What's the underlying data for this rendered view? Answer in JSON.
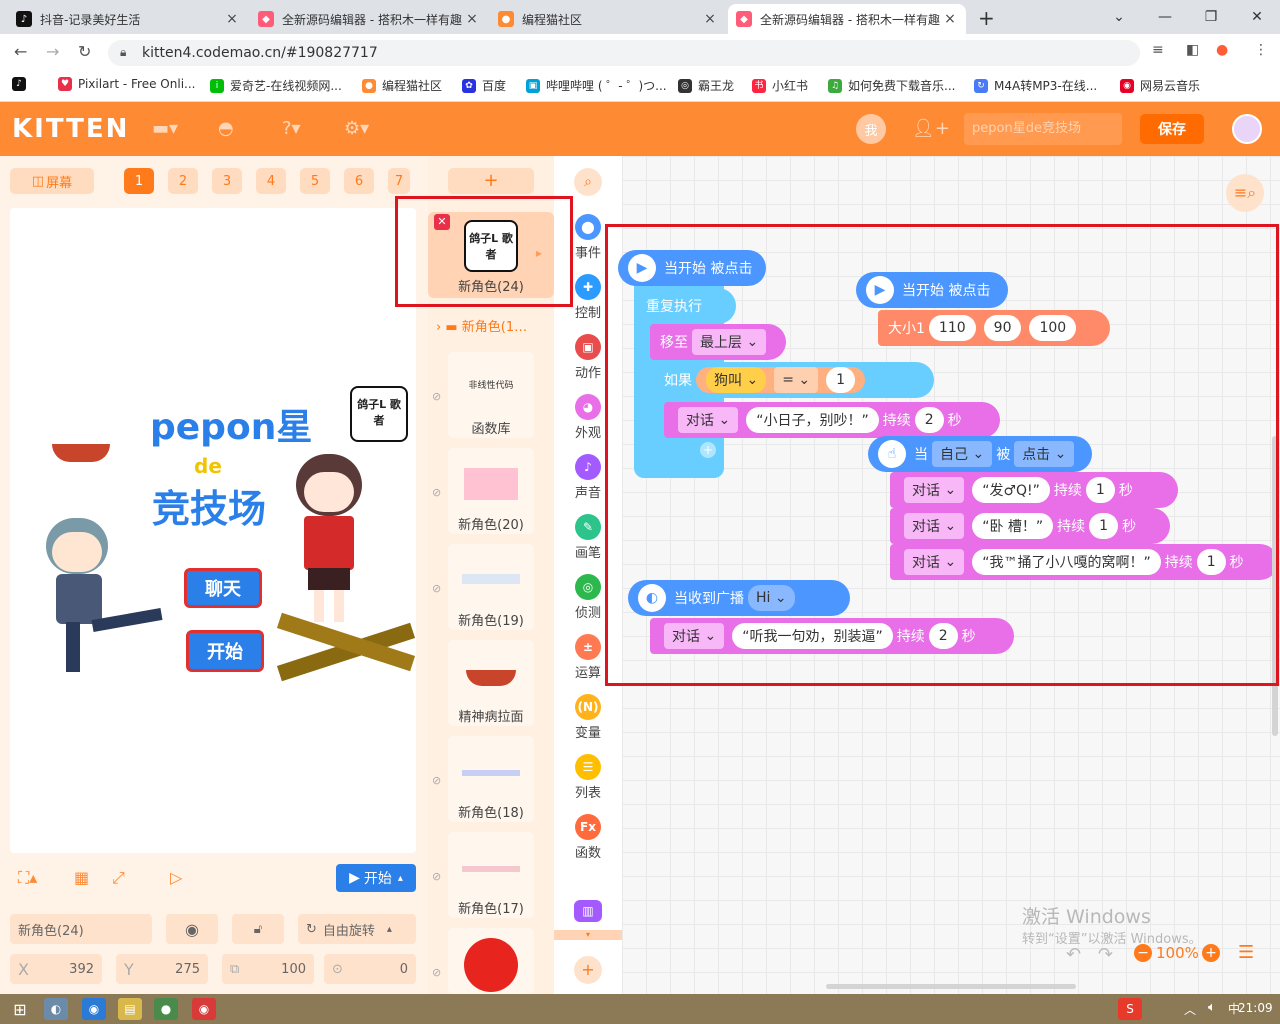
{
  "browser": {
    "tabs": [
      {
        "title": "抖音-记录美好生活",
        "active": false,
        "close": "×"
      },
      {
        "title": "全新源码编辑器 - 搭积木一样有趣",
        "active": false,
        "close": "×"
      },
      {
        "title": "编程猫社区",
        "active": false,
        "close": "×"
      },
      {
        "title": "全新源码编辑器 - 搭积木一样有趣",
        "active": true,
        "close": "×"
      }
    ],
    "new_tab": "+",
    "url": "kitten4.codemao.cn/#190827717",
    "bookmarks": [
      "Pixilart - Free Onli...",
      "爱奇艺-在线视频网...",
      "编程猫社区",
      "百度",
      "哔哩哔哩 ( ゜- ゜)つ...",
      "霸王龙",
      "小红书",
      "如何免费下载音乐...",
      "M4A转MP3-在线...",
      "网易云音乐"
    ]
  },
  "app": {
    "logo": "KITTEN",
    "me_label": "我",
    "project_name_placeholder": "pepon星de竞技场",
    "save_label": "保存"
  },
  "left": {
    "screen_toggle": "屏幕",
    "screens": [
      "1",
      "2",
      "3",
      "4",
      "5",
      "6",
      "7"
    ],
    "stage_title_1": "pepon星",
    "stage_title_2": "de",
    "stage_title_3": "竞技场",
    "stage_btn_chat": "聊天",
    "stage_btn_start": "开始",
    "sprite_badge": "鸽子L 歌者",
    "start_label": "开始",
    "sprite_name": "新角色(24)",
    "rotation_label": "自由旋转",
    "x_label": "X",
    "x_value": "392",
    "y_label": "Y",
    "y_value": "275",
    "size_value": "100",
    "angle_value": "0"
  },
  "sprites": {
    "add": "+",
    "selected_label": "新角色(24)",
    "selected_thumb": "鸽子L 歌者",
    "folder_label": "新角色(1…",
    "items": [
      "函数库",
      "新角色(20)",
      "新角色(19)",
      "精神病拉面",
      "新角色(18)",
      "新角色(17)"
    ],
    "item0_thumb": "非线性代码"
  },
  "categories": [
    "事件",
    "控制",
    "动作",
    "外观",
    "声音",
    "画笔",
    "侦测",
    "运算",
    "变量",
    "列表",
    "函数"
  ],
  "category_colors": [
    "#4c97ff",
    "#2b9bff",
    "#e84c4c",
    "#e86fe8",
    "#a35bff",
    "#2cc48a",
    "#2cb84c",
    "#ff7a52",
    "#ffb21a",
    "#ffbe00",
    "#ff6b3d"
  ],
  "blocks": {
    "when_start_1": "当开始 被点击",
    "repeat": "重复执行",
    "move_to": "移至",
    "top_layer": "最上层",
    "if": "如果",
    "dog": "狗叫",
    "eq": "=",
    "one": "1",
    "say": "对话",
    "say1_text": "“小日子，别吵！”",
    "last": "持续",
    "two": "2",
    "sec": "秒",
    "when_start_2": "当开始 被点击",
    "size": "大小1",
    "s1": "110",
    "s2": "90",
    "s3": "100",
    "when": "当",
    "self": "自己",
    "by": "被",
    "click": "点击",
    "say2_text": "“发♂Q!”",
    "say3_text": "“卧 槽！”",
    "say4_text": "“我™捅了小八嘎的窝啊！”",
    "on_broadcast": "当收到广播",
    "hi": "Hi",
    "say5_text": "“听我一句劝，别装逼”"
  },
  "workspace": {
    "zoom": "100%",
    "watermark_1": "激活 Windows",
    "watermark_2": "转到“设置”以激活 Windows。"
  },
  "taskbar": {
    "time": "21:09"
  }
}
